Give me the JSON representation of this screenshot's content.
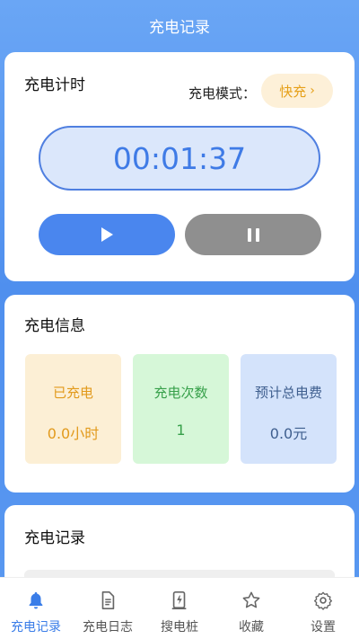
{
  "header": {
    "title": "充电记录"
  },
  "timer_card": {
    "title": "充电计时",
    "mode_label": "充电模式：",
    "mode_value": "快充",
    "mode_chevron": "›",
    "time": "00:01:37"
  },
  "info_card": {
    "title": "充电信息",
    "stats": [
      {
        "label": "已充电",
        "value": "0.0小时"
      },
      {
        "label": "充电次数",
        "value": "1"
      },
      {
        "label": "预计总电费",
        "value": "0.0元"
      }
    ]
  },
  "records_card": {
    "title": "充电记录"
  },
  "tabbar": {
    "items": [
      {
        "label": "充电记录",
        "icon": "bell-icon"
      },
      {
        "label": "充电日志",
        "icon": "document-icon"
      },
      {
        "label": "搜电桩",
        "icon": "charging-pile-icon"
      },
      {
        "label": "收藏",
        "icon": "star-icon"
      },
      {
        "label": "设置",
        "icon": "gear-icon"
      }
    ]
  },
  "colors": {
    "accent": "#3a7de8",
    "mode_pill": "#e6a019",
    "pause_button": "#8f8f8f"
  }
}
